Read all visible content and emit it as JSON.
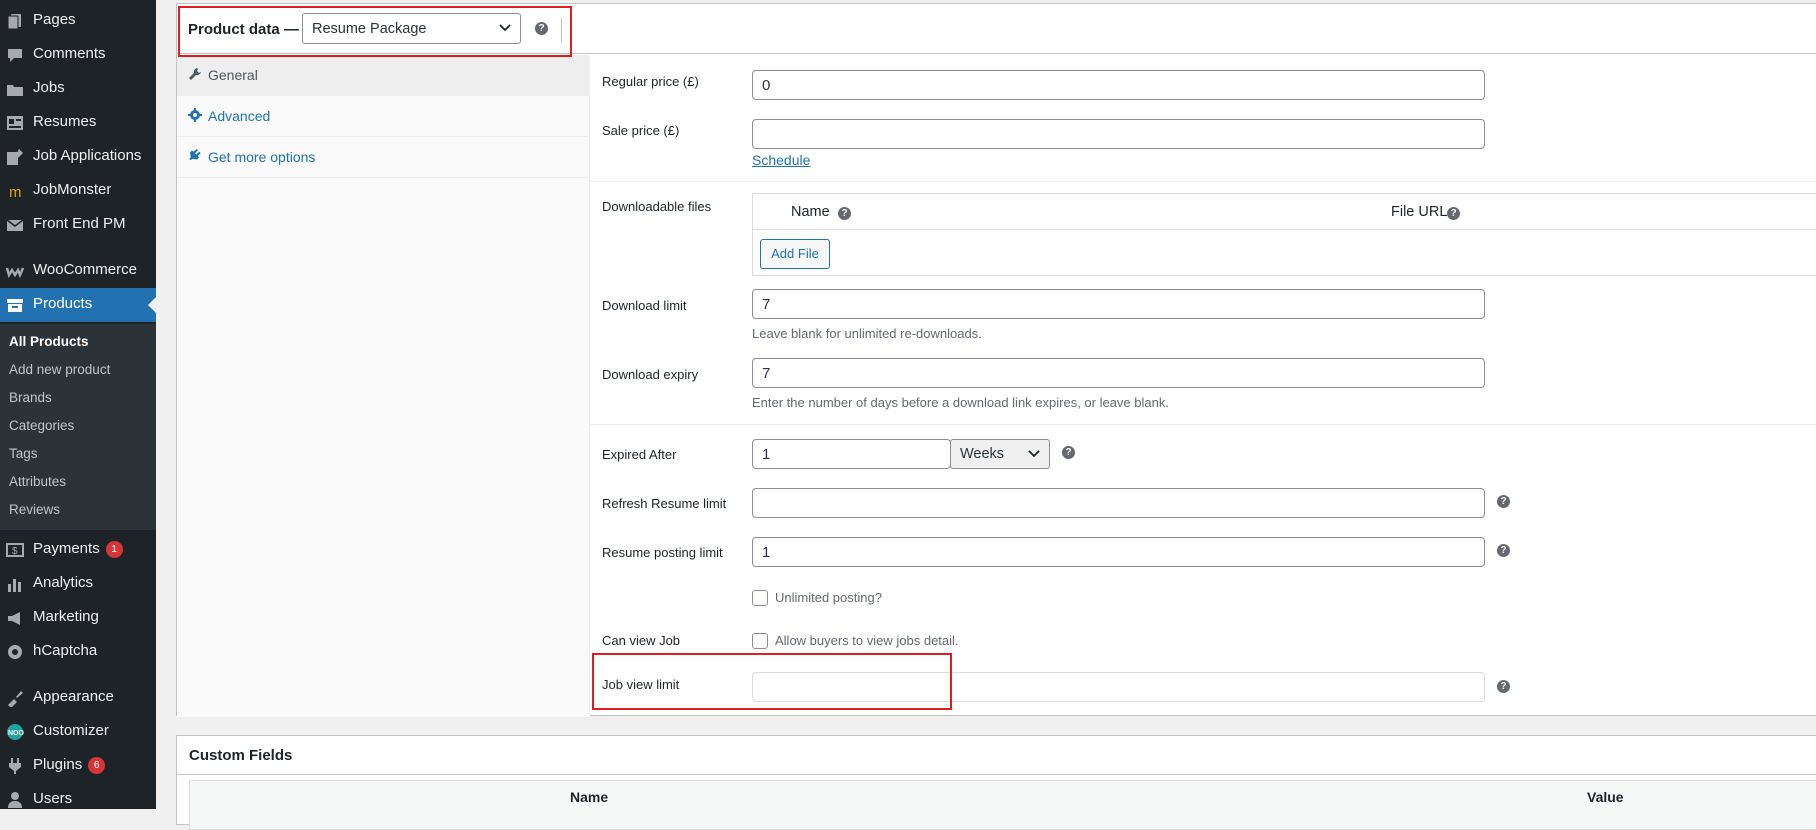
{
  "sidebar": {
    "items": [
      {
        "label": "Pages",
        "icon": "pages-icon"
      },
      {
        "label": "Comments",
        "icon": "comments-icon"
      },
      {
        "label": "Jobs",
        "icon": "jobs-icon"
      },
      {
        "label": "Resumes",
        "icon": "resumes-icon"
      },
      {
        "label": "Job Applications",
        "icon": "job-applications-icon"
      },
      {
        "label": "JobMonster",
        "icon": "jobmonster-icon"
      },
      {
        "label": "Front End PM",
        "icon": "mail-icon"
      },
      {
        "label": "WooCommerce",
        "icon": "woocommerce-icon"
      },
      {
        "label": "Products",
        "icon": "products-icon"
      },
      {
        "label": "Payments",
        "icon": "payments-icon",
        "badge": "1"
      },
      {
        "label": "Analytics",
        "icon": "analytics-icon"
      },
      {
        "label": "Marketing",
        "icon": "marketing-icon"
      },
      {
        "label": "hCaptcha",
        "icon": "hcaptcha-icon"
      },
      {
        "label": "Appearance",
        "icon": "appearance-icon"
      },
      {
        "label": "Customizer",
        "icon": "customizer-icon"
      },
      {
        "label": "Plugins",
        "icon": "plugins-icon",
        "badge": "6"
      },
      {
        "label": "Users",
        "icon": "users-icon"
      }
    ],
    "submenu": [
      "All Products",
      "Add new product",
      "Brands",
      "Categories",
      "Tags",
      "Attributes",
      "Reviews"
    ]
  },
  "product_data": {
    "title": "Product data —",
    "type_select": "Resume Package",
    "tabs": [
      "General",
      "Advanced",
      "Get more options"
    ]
  },
  "general": {
    "regular_price_label": "Regular price (£)",
    "regular_price_value": "0",
    "sale_price_label": "Sale price (£)",
    "sale_price_value": "",
    "schedule_link": "Schedule",
    "downloadable_files_label": "Downloadable files",
    "files_col_name": "Name",
    "files_col_url": "File URL",
    "add_file_button": "Add File",
    "download_limit_label": "Download limit",
    "download_limit_value": "7",
    "download_limit_desc": "Leave blank for unlimited re-downloads.",
    "download_expiry_label": "Download expiry",
    "download_expiry_value": "7",
    "download_expiry_desc": "Enter the number of days before a download link expires, or leave blank.",
    "expired_after_label": "Expired After",
    "expired_after_value": "1",
    "expired_after_unit": "Weeks",
    "refresh_resume_label": "Refresh Resume limit",
    "refresh_resume_value": "",
    "resume_posting_label": "Resume posting limit",
    "resume_posting_value": "1",
    "unlimited_posting_label": "Unlimited posting?",
    "can_view_job_label": "Can view Job",
    "allow_buyers_label": "Allow buyers to view jobs detail.",
    "job_view_limit_label": "Job view limit",
    "job_view_limit_value": ""
  },
  "custom_fields": {
    "title": "Custom Fields",
    "col_name": "Name",
    "col_value": "Value"
  }
}
